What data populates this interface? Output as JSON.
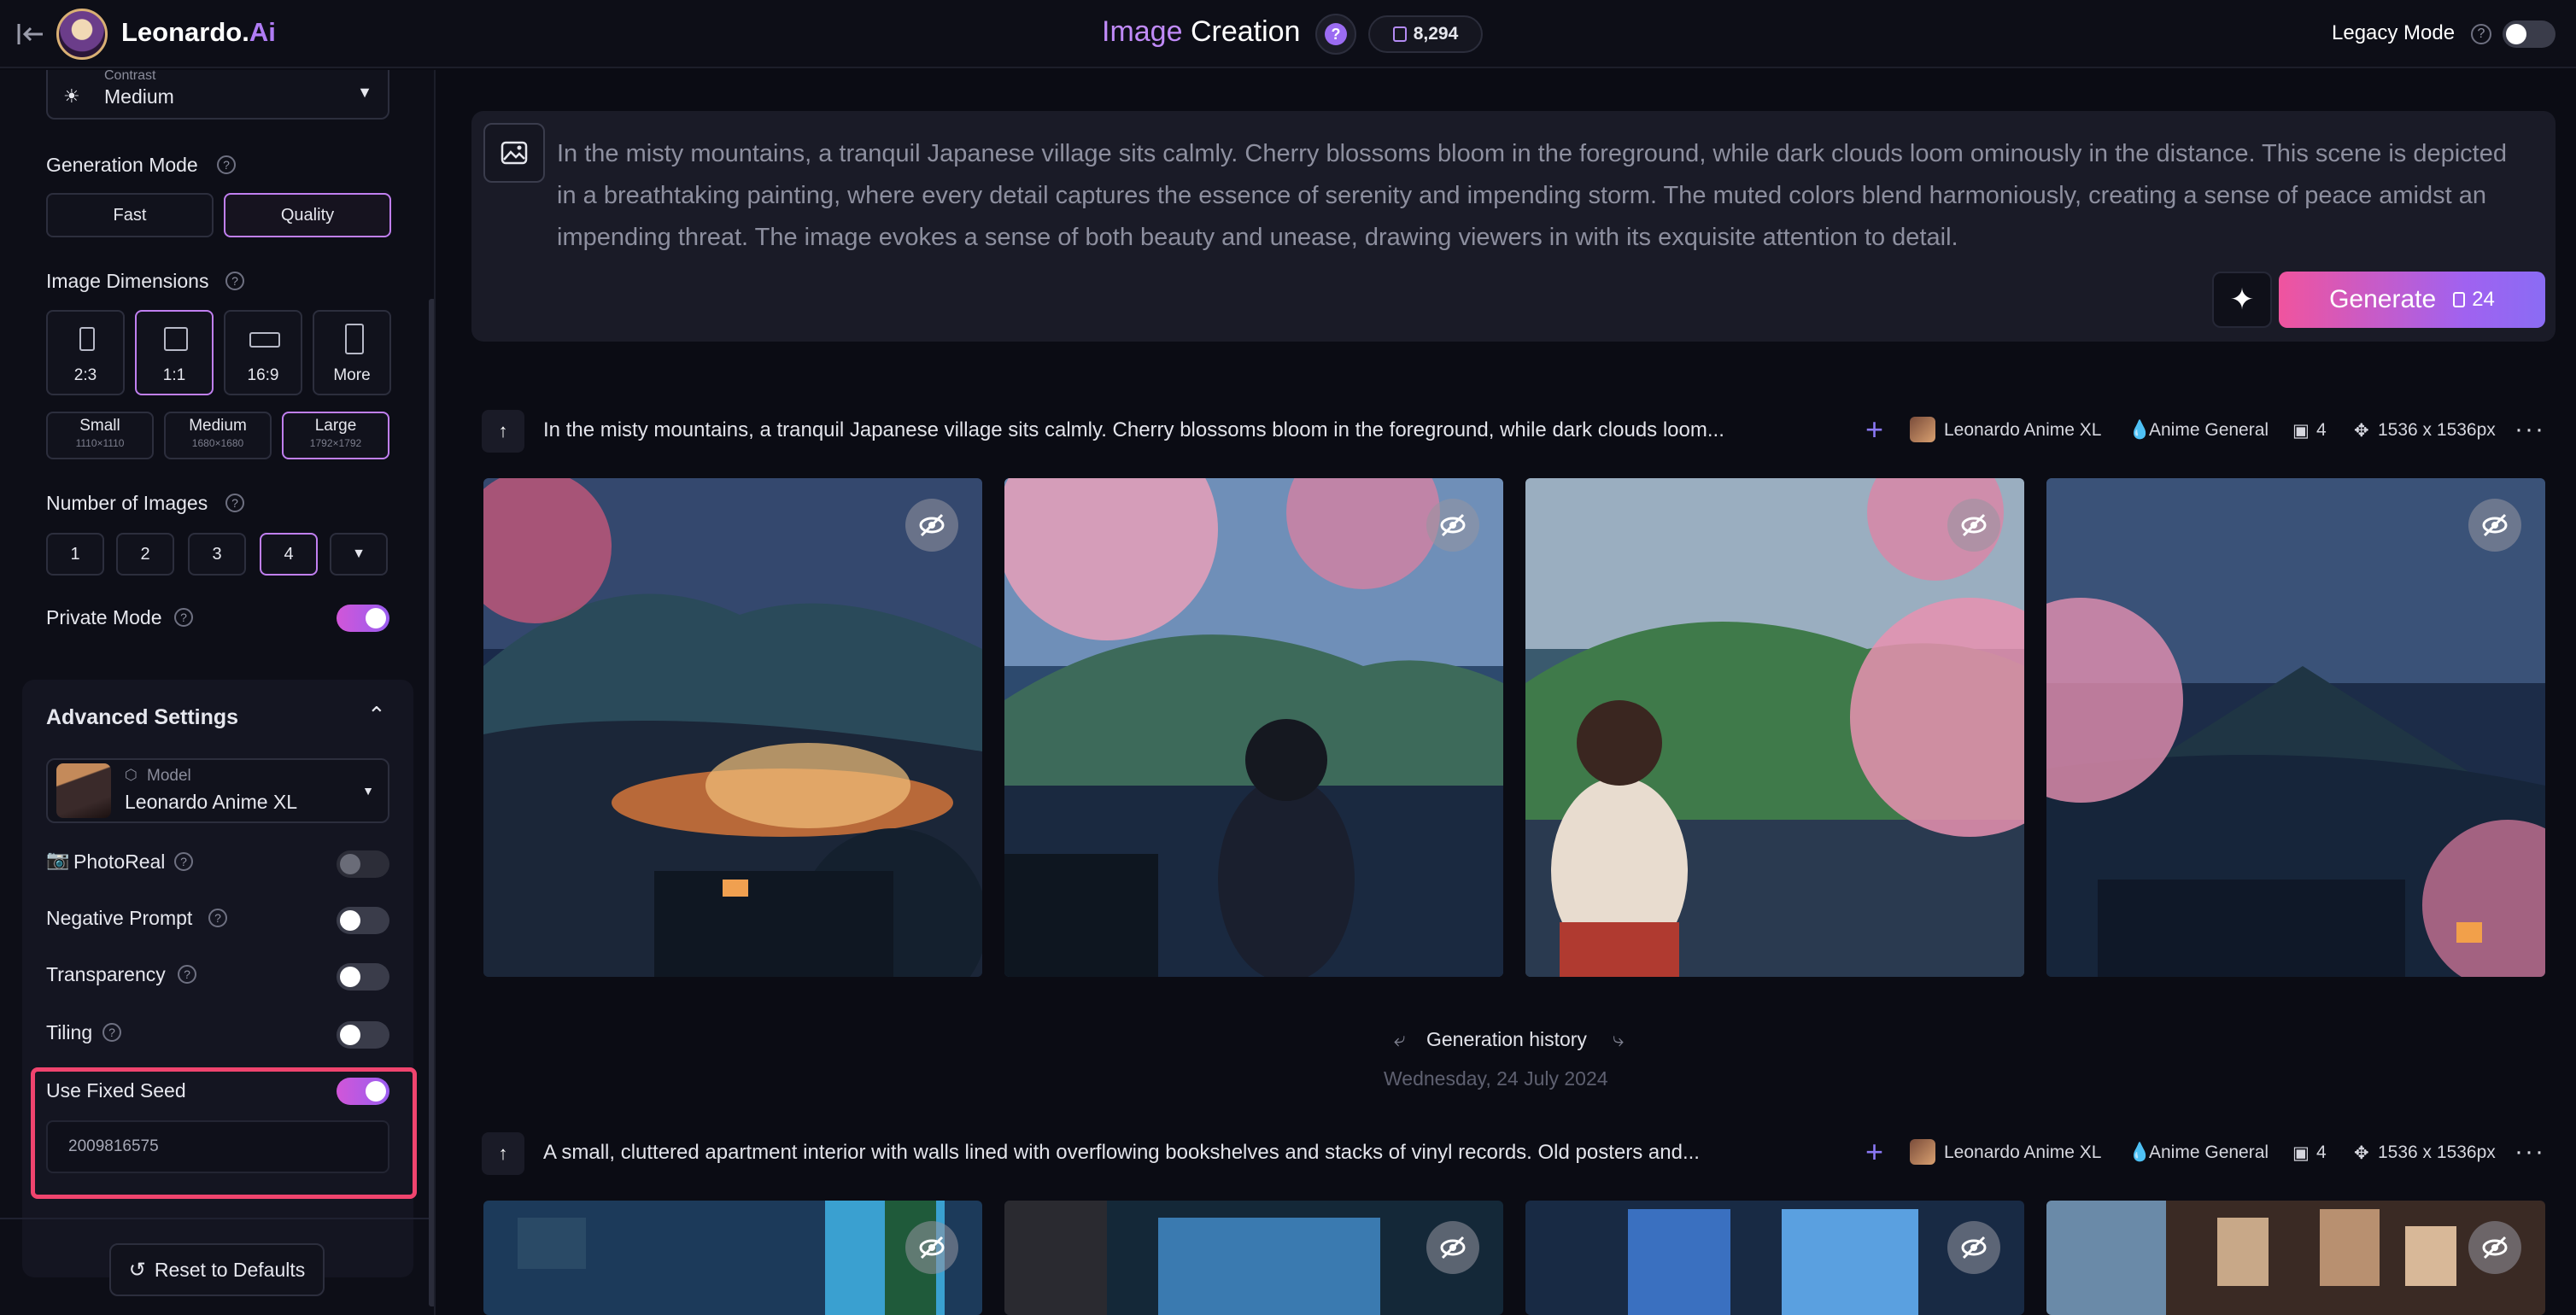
{
  "app": {
    "name_part1": "Leonardo.",
    "name_part2": "Ai",
    "title_part1": "Image",
    "title_part2": " Creation",
    "help_glyph": "?",
    "tokens": "8,294",
    "legacy_label": "Legacy Mode",
    "legacy_help": "?"
  },
  "sidebar": {
    "contrast_label": "Contrast",
    "contrast_value": "Medium",
    "generation_mode_label": "Generation Mode",
    "mode_fast": "Fast",
    "mode_quality": "Quality",
    "image_dimensions_label": "Image Dimensions",
    "ratios": [
      "2:3",
      "1:1",
      "16:9",
      "More"
    ],
    "sizes": [
      {
        "name": "Small",
        "px": "1110×1110"
      },
      {
        "name": "Medium",
        "px": "1680×1680"
      },
      {
        "name": "Large",
        "px": "1792×1792"
      }
    ],
    "number_of_images_label": "Number of Images",
    "counts": [
      "1",
      "2",
      "3",
      "4"
    ],
    "private_mode_label": "Private Mode",
    "advanced_settings_label": "Advanced Settings",
    "model_caption": "Model",
    "model_name": "Leonardo Anime XL",
    "photoreal_label": "PhotoReal",
    "negative_prompt_label": "Negative Prompt",
    "transparency_label": "Transparency",
    "tiling_label": "Tiling",
    "fixed_seed_label": "Use Fixed Seed",
    "seed_value": "2009816575",
    "reset_label": "Reset to Defaults",
    "hint_glyph": "?"
  },
  "prompt": {
    "text": "In the misty mountains, a tranquil Japanese village sits calmly. Cherry blossoms bloom in the foreground, while dark clouds loom ominously in the distance. This scene is depicted in a breathtaking painting, where every detail captures the essence of serenity and impending storm. The muted colors blend harmoniously, creating a sense of peace amidst an impending threat. The image evokes a sense of both beauty and unease, drawing viewers in with its exquisite attention to detail.",
    "generate_label": "Generate",
    "generate_cost": "24"
  },
  "generations": [
    {
      "prompt": "In the misty mountains, a tranquil Japanese village sits calmly. Cherry blossoms bloom in the foreground, while dark clouds loom...",
      "model": "Leonardo Anime XL",
      "style": "Anime General",
      "count": "4",
      "size": "1536 x 1536px"
    },
    {
      "prompt": "A small, cluttered apartment interior with walls lined with overflowing bookshelves and stacks of vinyl records. Old posters and...",
      "model": "Leonardo Anime XL",
      "style": "Anime General",
      "count": "4",
      "size": "1536 x 1536px"
    }
  ],
  "history": {
    "label": "Generation history",
    "date": "Wednesday, 24 July 2024"
  },
  "colors": {
    "accent": "#c07ff0",
    "highlight": "#f0446e",
    "background": "#0b0c14"
  }
}
